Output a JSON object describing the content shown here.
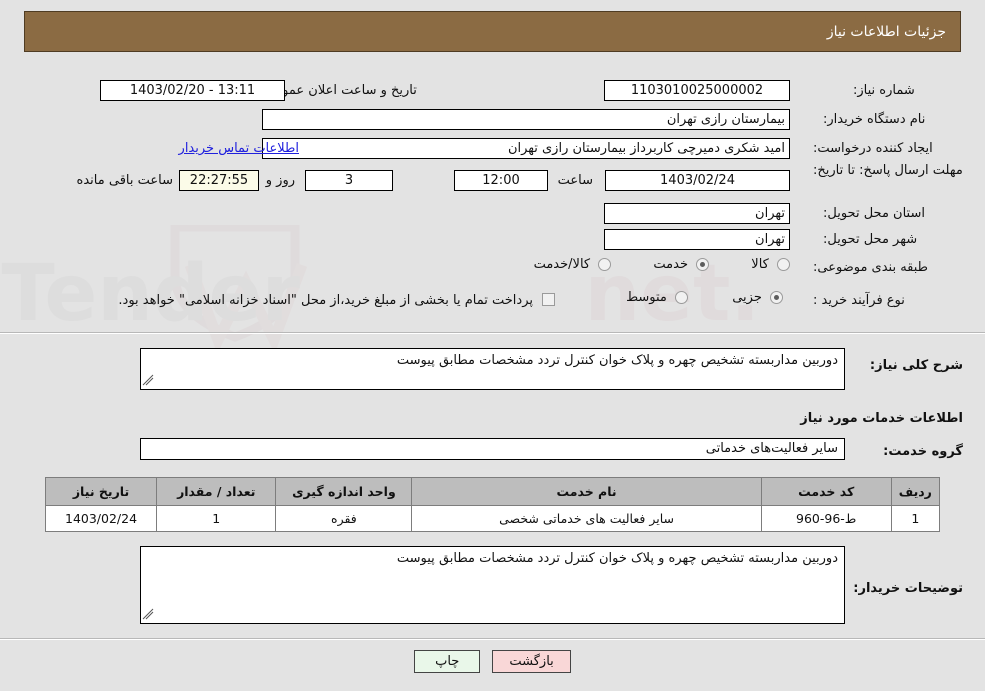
{
  "header": {
    "title": "جزئیات اطلاعات نیاز"
  },
  "fields": {
    "need_number_label": "شماره نیاز:",
    "need_number_value": "1103010025000002",
    "announce_label": "تاریخ و ساعت اعلان عمومی:",
    "announce_value": "13:11 - 1403/02/20",
    "buyer_org_label": "نام دستگاه خریدار:",
    "buyer_org_value": "بیمارستان رازی تهران",
    "requester_label": "ایجاد کننده درخواست:",
    "requester_value": "امید شکری دمیرچی کاربرداز بیمارستان رازی تهران",
    "contact_link": "اطلاعات تماس خریدار",
    "deadline_label": "مهلت ارسال پاسخ: تا تاریخ:",
    "deadline_date": "1403/02/24",
    "hour_label": "ساعت",
    "deadline_time": "12:00",
    "days_left": "3",
    "days_and_label": "روز و",
    "countdown": "22:27:55",
    "remaining_label": "ساعت باقی مانده",
    "province_label": "استان محل تحویل:",
    "province_value": "تهران",
    "city_label": "شهر محل تحویل:",
    "city_value": "تهران",
    "category_label": "طبقه بندی موضوعی:",
    "process_label": "نوع فرآیند خرید :",
    "treasury_note": "پرداخت تمام یا بخشی از مبلغ خرید،از محل \"اسناد خزانه اسلامی\" خواهد بود."
  },
  "category_options": [
    {
      "label": "کالا",
      "selected": false
    },
    {
      "label": "خدمت",
      "selected": true
    },
    {
      "label": "کالا/خدمت",
      "selected": false
    }
  ],
  "process_options": [
    {
      "label": "جزیی",
      "selected": true
    },
    {
      "label": "متوسط",
      "selected": false
    }
  ],
  "treasury_checkbox_checked": false,
  "description": {
    "label": "شرح کلی نیاز:",
    "value": "دوربین مداربسته تشخیص چهره و پلاک خوان کنترل تردد مشخصات مطابق پیوست"
  },
  "services_section": {
    "heading": "اطلاعات خدمات مورد نیاز",
    "group_label": "گروه خدمت:",
    "group_value": "سایر فعالیت‌های خدماتی"
  },
  "table": {
    "columns": [
      "ردیف",
      "کد خدمت",
      "نام خدمت",
      "واحد اندازه گیری",
      "تعداد / مقدار",
      "تاریخ نیاز"
    ],
    "rows": [
      {
        "index": "1",
        "service_code": "ط-96-960",
        "service_name": "سایر فعالیت های خدماتی شخصی",
        "unit": "فقره",
        "quantity": "1",
        "need_date": "1403/02/24"
      }
    ]
  },
  "buyer_notes": {
    "label": "توضیحات خریدار:",
    "value": "دوربین مداربسته تشخیص چهره و پلاک خوان کنترل تردد مشخصات مطابق پیوست"
  },
  "buttons": {
    "print": "چاپ",
    "back": "بازگشت"
  },
  "watermark": {
    "text": "AriaTender.net"
  },
  "colors": {
    "header_bg": "#8b6b43",
    "link": "#2020dd",
    "print_btn": "#e9f7e9",
    "back_btn": "#f9d7d7",
    "countdown_bg": "#fbfbe8",
    "table_header_bg": "#bdbdbd"
  }
}
